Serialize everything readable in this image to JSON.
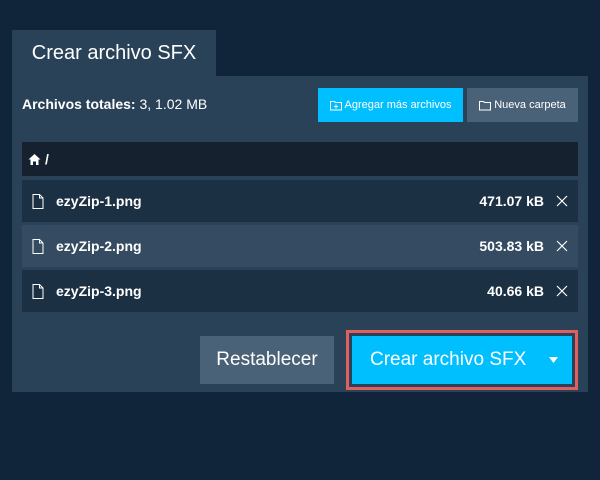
{
  "tab": {
    "title": "Crear archivo SFX"
  },
  "toolbar": {
    "totals_label": "Archivos totales:",
    "totals_value": "3, 1.02 MB",
    "add_files_label": "Agregar más archivos",
    "new_folder_label": "Nueva carpeta"
  },
  "path": {
    "current": "/"
  },
  "files": [
    {
      "name": "ezyZip-1.png",
      "size": "471.07 kB"
    },
    {
      "name": "ezyZip-2.png",
      "size": "503.83 kB"
    },
    {
      "name": "ezyZip-3.png",
      "size": "40.66 kB"
    }
  ],
  "actions": {
    "reset_label": "Restablecer",
    "create_label": "Crear archivo SFX"
  },
  "colors": {
    "background": "#10253a",
    "panel": "#2a4258",
    "accent": "#00bfff",
    "secondary_button": "#4a6278",
    "highlight_outline": "#e06060"
  },
  "icons": {
    "add_files": "folder-plus-icon",
    "new_folder": "folder-icon",
    "home": "home-icon",
    "file": "file-icon",
    "remove": "close-icon",
    "dropdown": "caret-down-icon"
  }
}
